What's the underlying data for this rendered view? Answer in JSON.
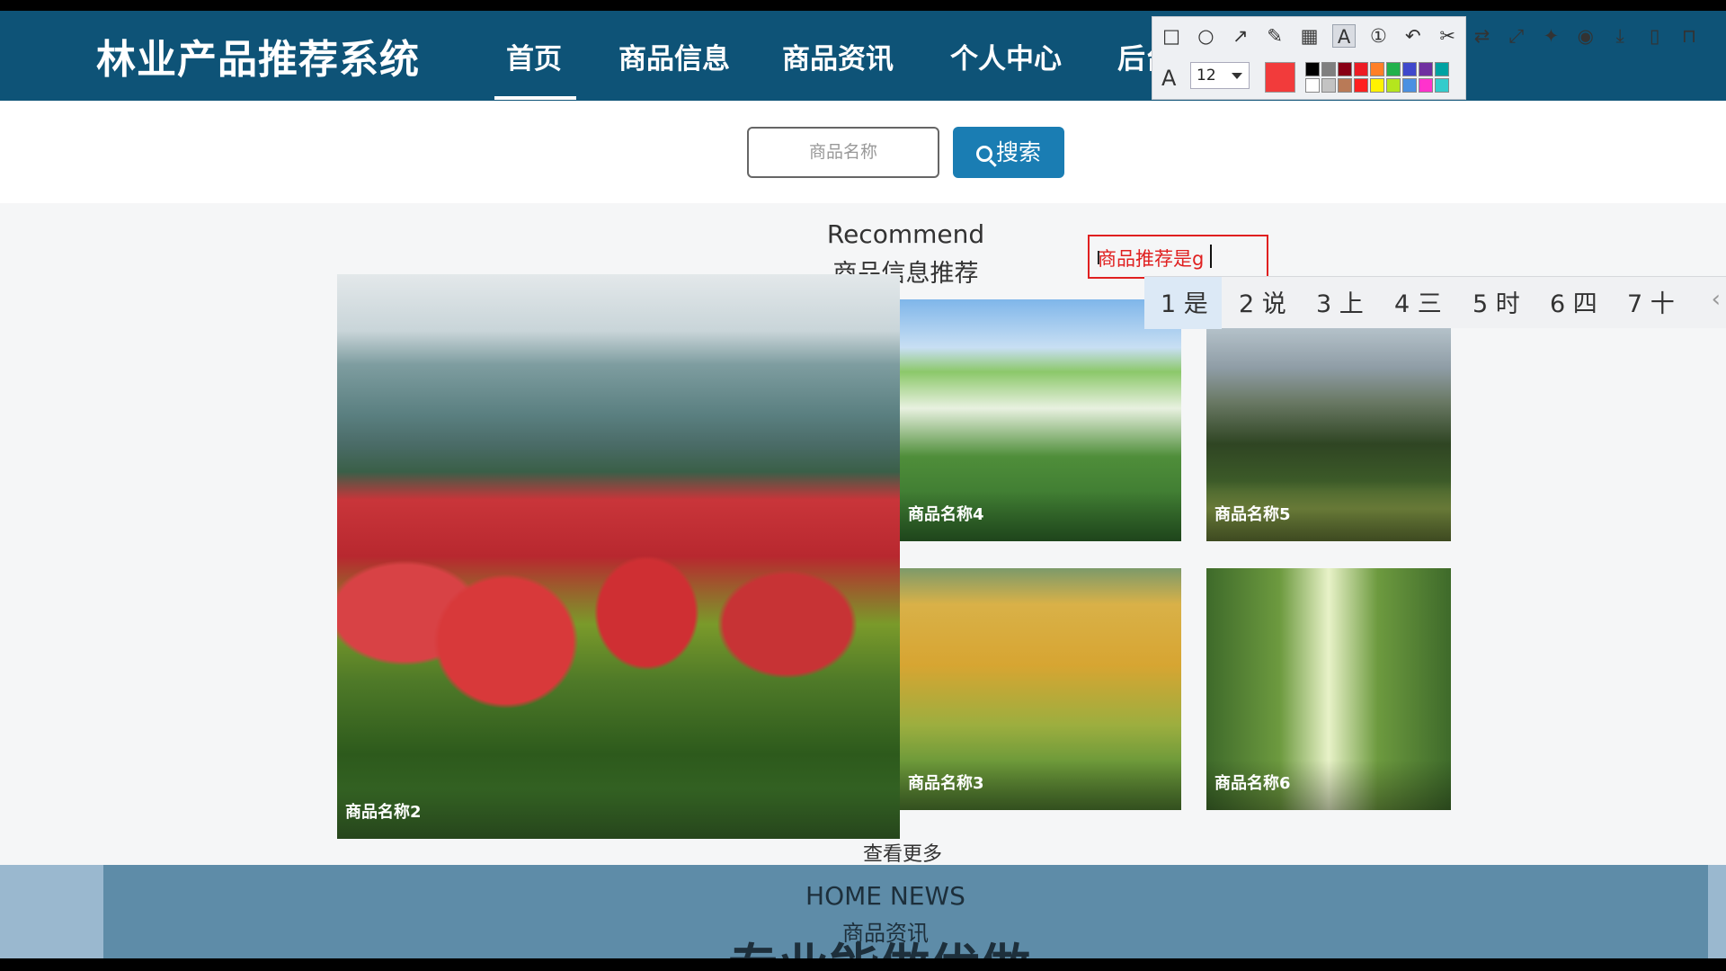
{
  "site": {
    "title": "林业产品推荐系统",
    "nav": [
      "首页",
      "商品信息",
      "商品资讯",
      "个人中心",
      "后台管理"
    ],
    "nav_active": "首页"
  },
  "search": {
    "placeholder": "商品名称",
    "button_label": "搜索"
  },
  "recommend": {
    "heading_en": "Recommend",
    "heading_cn": "商品信息推荐",
    "items": [
      {
        "caption": "商品名称2"
      },
      {
        "caption": "商品名称4"
      },
      {
        "caption": "商品名称5"
      },
      {
        "caption": "商品名称3"
      },
      {
        "caption": "商品名称6"
      }
    ],
    "view_more": "查看更多"
  },
  "news": {
    "heading_en": "HOME NEWS",
    "heading_cn": "商品资讯",
    "featured_title": "专业能做优做"
  },
  "capture_tool": {
    "font_size": "12",
    "current_color": "#f23b3b",
    "palette_top": [
      "#000000",
      "#7f7f7f",
      "#880015",
      "#ed1c24",
      "#ff7f27",
      "#22b14c",
      "#3f48cc",
      "#7030a0",
      "#00a2a2"
    ],
    "palette_bottom": [
      "#ffffff",
      "#c3c3c3",
      "#b97a57",
      "#ff2020",
      "#fff200",
      "#b5e61d",
      "#4a90e2",
      "#ff33cc",
      "#33cccc"
    ],
    "tools": [
      "rectangle-icon",
      "ellipse-icon",
      "arrow-icon",
      "pencil-icon",
      "mosaic-icon",
      "text-icon",
      "number-icon",
      "undo-icon",
      "cut-icon",
      "translate-icon",
      "fullscreen-icon",
      "pin-icon",
      "record-icon",
      "download-icon",
      "phone-icon",
      "bookmark-icon"
    ]
  },
  "annotation": {
    "text": "商品推荐是g"
  },
  "ime": {
    "candidates": [
      "1 是",
      "2 说",
      "3 上",
      "4 三",
      "5 时",
      "6 四",
      "7 十"
    ]
  }
}
